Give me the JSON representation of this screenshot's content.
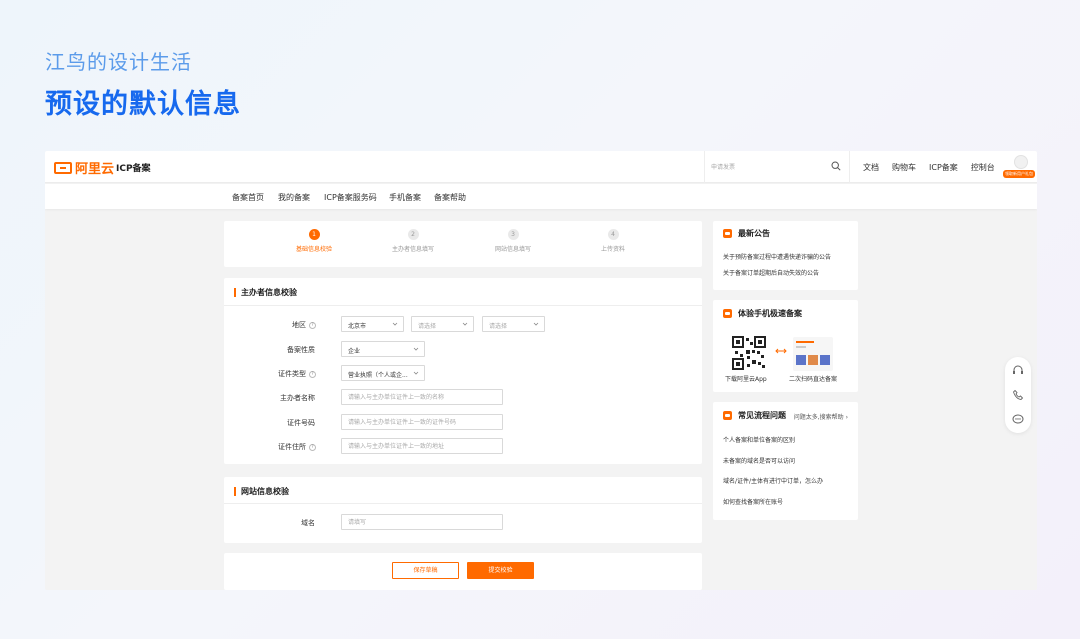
{
  "header": {
    "subtitle": "江鸟的设计生活",
    "title": "预设的默认信息"
  },
  "topbar": {
    "logo_text": "阿里云",
    "product": "ICP备案",
    "search_placeholder": "申请发票",
    "links": [
      "文档",
      "购物车",
      "ICP备案",
      "控制台"
    ],
    "badge": "领取新用户礼包"
  },
  "subnav": {
    "items": [
      "备案首页",
      "我的备案",
      "ICP备案服务码",
      "手机备案",
      "备案帮助"
    ]
  },
  "steps": [
    {
      "num": "1",
      "label": "基础信息校验",
      "active": true
    },
    {
      "num": "2",
      "label": "主办者信息填写",
      "active": false
    },
    {
      "num": "3",
      "label": "网站信息填写",
      "active": false
    },
    {
      "num": "4",
      "label": "上传资料",
      "active": false
    }
  ],
  "sponsor_section": {
    "title": "主办者信息校验",
    "region_label": "地区",
    "region_values": [
      "北京市",
      "请选择",
      "请选择"
    ],
    "nature_label": "备案性质",
    "nature_value": "企业",
    "id_type_label": "证件类型",
    "id_type_value": "营业执照（个人或企...",
    "name_label": "主办者名称",
    "name_placeholder": "请输入与主办单位证件上一致的名称",
    "id_no_label": "证件号码",
    "id_no_placeholder": "请输入与主办单位证件上一致的证件号码",
    "address_label": "证件住所",
    "address_placeholder": "请输入与主办单位证件上一致的地址"
  },
  "website_section": {
    "title": "网站信息校验",
    "domain_label": "域名",
    "domain_placeholder": "请填写"
  },
  "actions": {
    "save": "保存草稿",
    "submit": "提交校验"
  },
  "announcements": {
    "title": "最新公告",
    "items": [
      "关于预防备案过程中遭遇快递诈骗的公告",
      "关于备案订单超期后自动失效的公告"
    ]
  },
  "mobile": {
    "title": "体验手机极速备案",
    "caption_app": "下载阿里云App",
    "caption_scan": "二次扫码直达备案"
  },
  "faq": {
    "title": "常见流程问题",
    "more": "问题太多,搜索帮助",
    "items": [
      "个人备案和单位备案的区别",
      "未备案的域名是否可以访问",
      "域名/证件/主体有进行中订单，怎么办",
      "如何查找备案所在账号"
    ]
  },
  "colors": {
    "accent": "#ff6a00",
    "heading": "#1769ee",
    "subtitle": "#5b9bea"
  }
}
